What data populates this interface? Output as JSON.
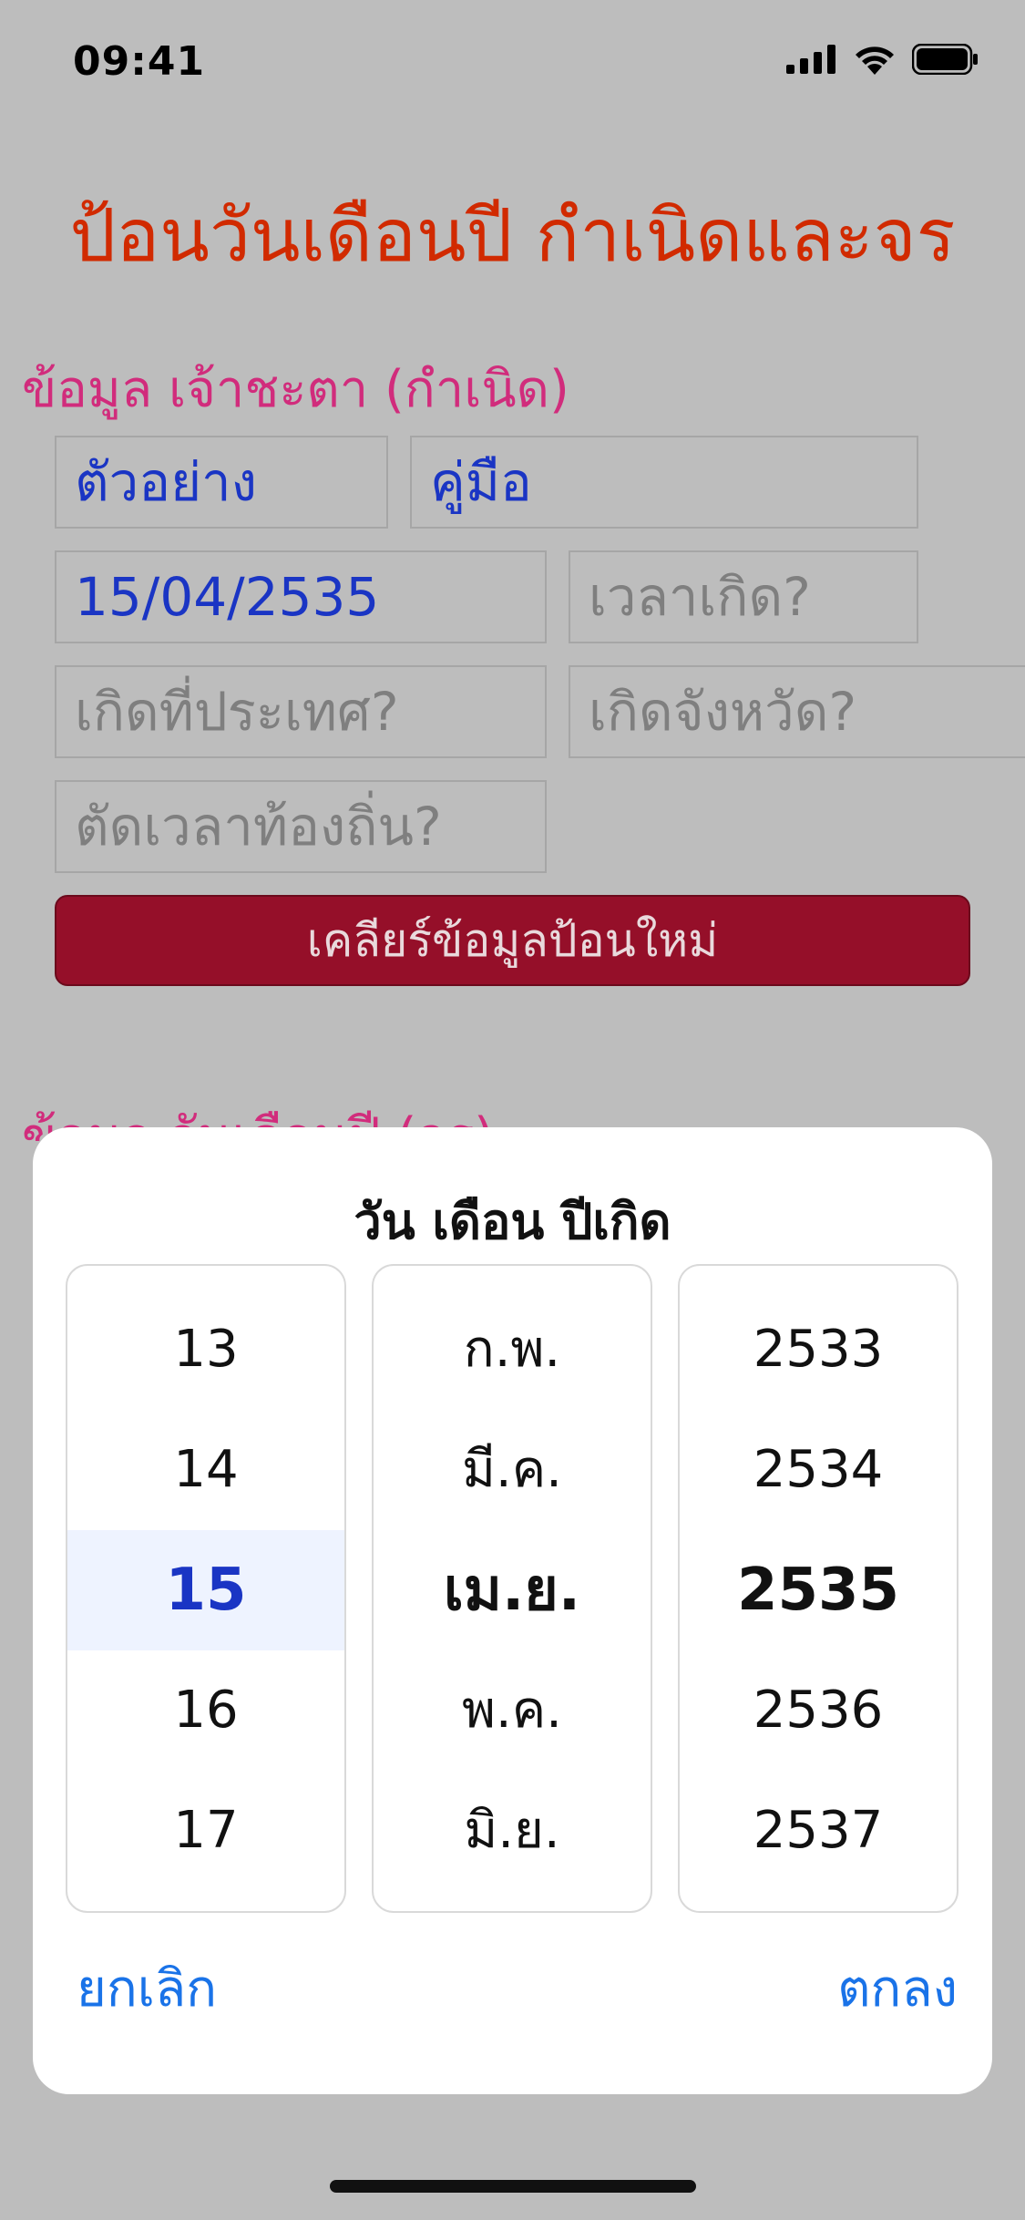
{
  "status_bar": {
    "time": "09:41"
  },
  "page": {
    "title": "ป้อนวันเดือนปี กำเนิดและจร",
    "section_birth_title": "ข้อมูล เจ้าชะตา (กำเนิด)",
    "section_transit_title": "ข้อมูล วันเดือนปี (จร)"
  },
  "form": {
    "first_name": "ตัวอย่าง",
    "last_name": "คู่มือ",
    "birth_date": "15/04/2535",
    "birth_time_placeholder": "เวลาเกิด?",
    "birth_country_placeholder": "เกิดที่ประเทศ?",
    "birth_province_placeholder": "เกิดจังหวัด?",
    "local_time_placeholder": "ตัดเวลาท้องถิ่น?",
    "clear_button": "เคลียร์ข้อมูลป้อนใหม่"
  },
  "date_picker": {
    "title": "วัน เดือน ปีเกิด",
    "days": [
      "13",
      "14",
      "15",
      "16",
      "17"
    ],
    "months": [
      "ก.พ.",
      "มี.ค.",
      "เม.ย.",
      "พ.ค.",
      "มิ.ย."
    ],
    "years": [
      "2533",
      "2534",
      "2535",
      "2536",
      "2537"
    ],
    "selected_index": 2,
    "cancel_label": "ยกเลิก",
    "ok_label": "ตกลง"
  },
  "colors": {
    "title_red": "#d12a00",
    "section_pink": "#d12c7c",
    "value_blue": "#1a35c4",
    "button_maroon": "#950f29",
    "action_blue": "#1a73e8",
    "selected_day_blue": "#1a35c4",
    "backdrop_gray": "#bdbdbd"
  }
}
